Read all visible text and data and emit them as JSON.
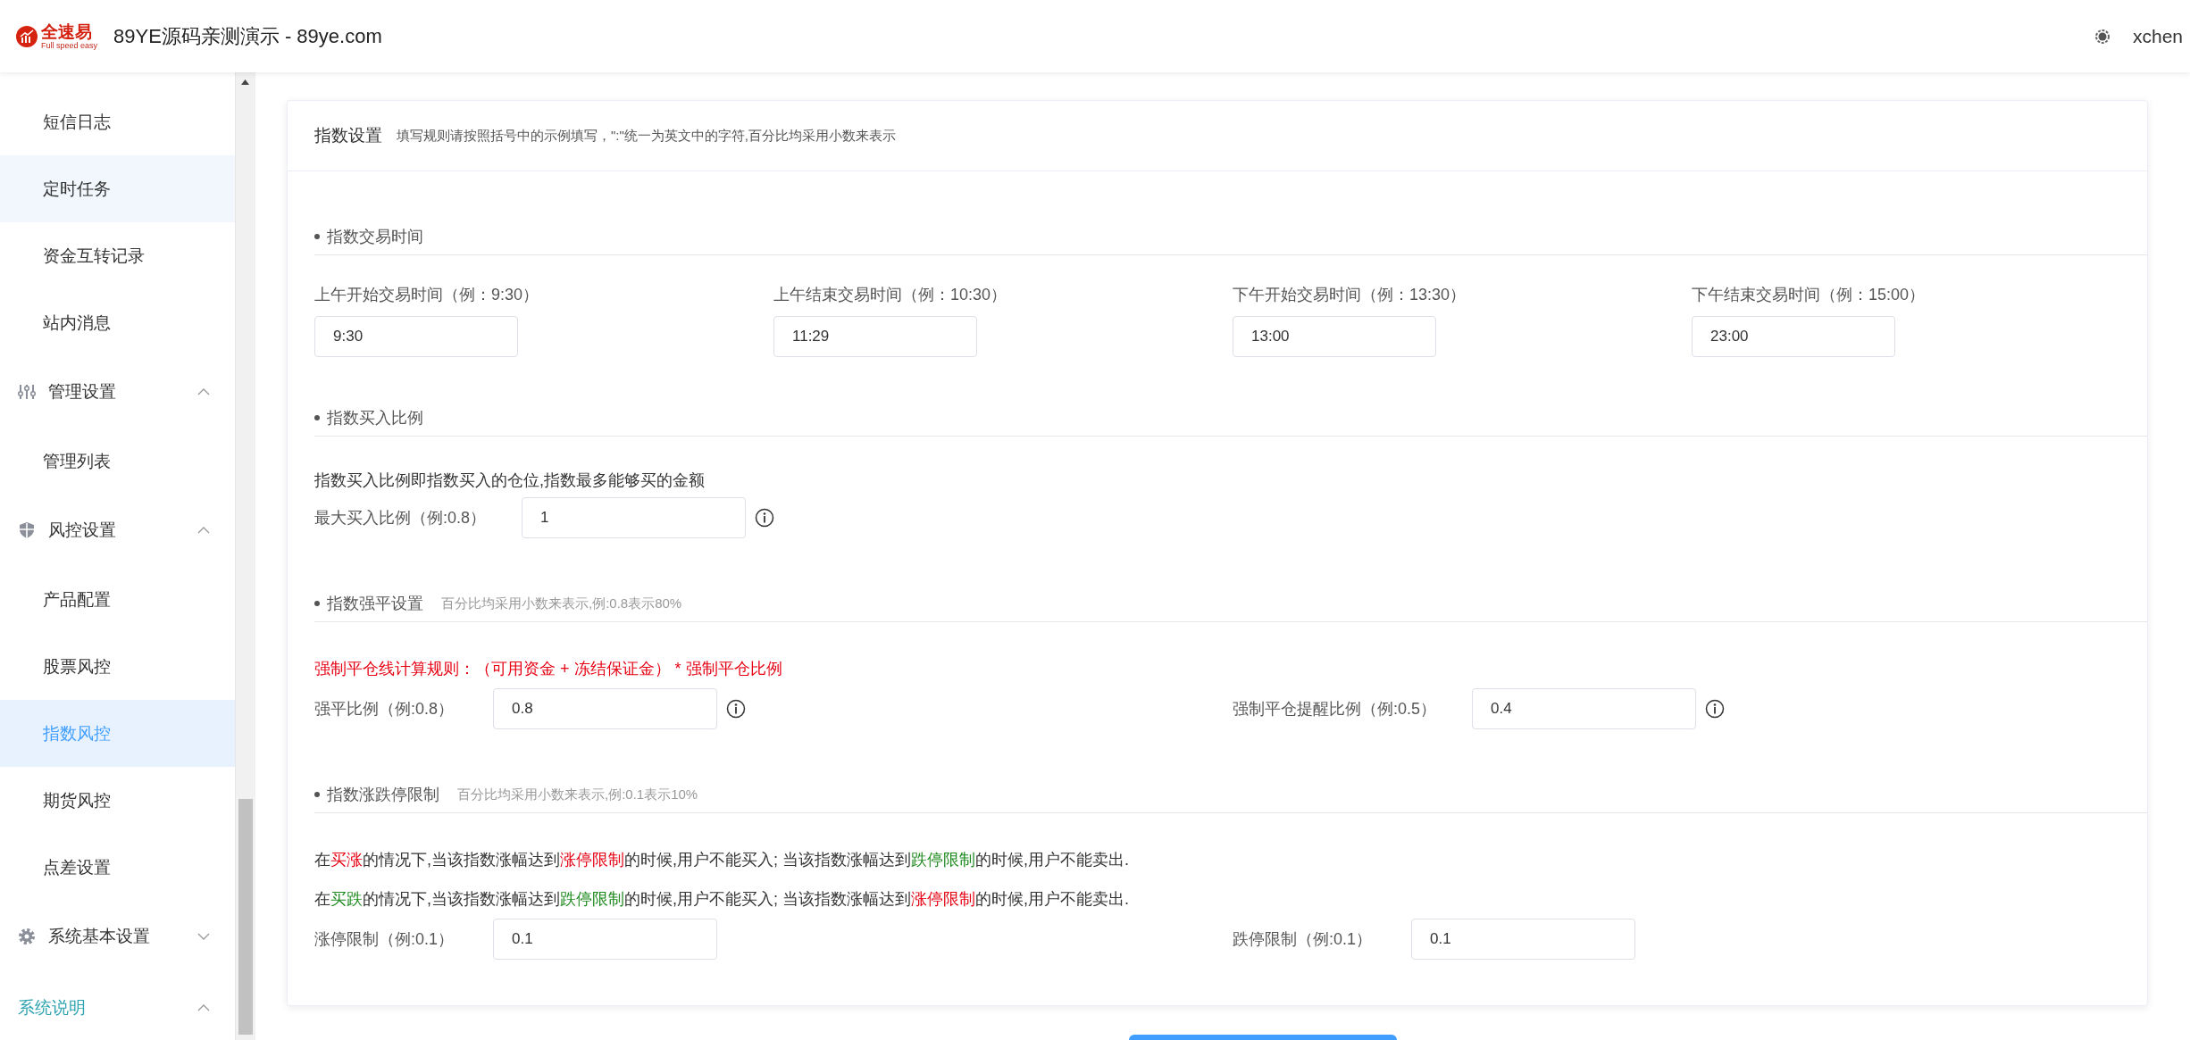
{
  "header": {
    "brand": "全速易",
    "brand_sub": "Full speed easy",
    "title": "89YE源码亲测演示 - 89ye.com",
    "user": "xchen"
  },
  "sidebar": {
    "items": [
      {
        "kind": "leaf",
        "label": "短信日志",
        "selected": false,
        "highlighted": false
      },
      {
        "kind": "leaf",
        "label": "定时任务",
        "selected": false,
        "highlighted": true
      },
      {
        "kind": "leaf",
        "label": "资金互转记录",
        "selected": false,
        "highlighted": false
      },
      {
        "kind": "leaf",
        "label": "站内消息",
        "selected": false,
        "highlighted": false
      },
      {
        "kind": "group",
        "label": "管理设置",
        "expanded": true,
        "active": false,
        "children": [
          {
            "label": "管理列表",
            "selected": false,
            "highlighted": false
          }
        ]
      },
      {
        "kind": "group",
        "label": "风控设置",
        "expanded": true,
        "active": false,
        "children": [
          {
            "label": "产品配置",
            "selected": false,
            "highlighted": false
          },
          {
            "label": "股票风控",
            "selected": false,
            "highlighted": false
          },
          {
            "label": "指数风控",
            "selected": true,
            "highlighted": false
          },
          {
            "label": "期货风控",
            "selected": false,
            "highlighted": false
          },
          {
            "label": "点差设置",
            "selected": false,
            "highlighted": false
          }
        ]
      },
      {
        "kind": "group",
        "label": "系统基本设置",
        "expanded": false,
        "active": false
      },
      {
        "kind": "group",
        "label": "系统说明",
        "expanded": true,
        "active": true
      }
    ]
  },
  "card": {
    "title": "指数设置",
    "hint": "填写规则请按照括号中的示例填写，\":\"统一为英文中的字符,百分比均采用小数来表示",
    "sections": [
      {
        "kind": "stacked",
        "title": "指数交易时间",
        "fields": [
          {
            "label": "上午开始交易时间（例：9:30）",
            "value": "9:30",
            "info": false
          },
          {
            "label": "上午结束交易时间（例：10:30）",
            "value": "11:29",
            "info": false
          },
          {
            "label": "下午开始交易时间（例：13:30）",
            "value": "13:00",
            "info": false
          },
          {
            "label": "下午结束交易时间（例：15:00）",
            "value": "23:00",
            "info": false
          }
        ]
      },
      {
        "kind": "inline",
        "title": "指数买入比例",
        "notes": [
          {
            "segments": [
              {
                "text": "指数买入比例即指数买入的仓位,指数最多能够买的金额",
                "color": "#333333"
              }
            ]
          }
        ],
        "fields": [
          {
            "label": "最大买入比例（例:0.8）",
            "value": "1",
            "info": true
          }
        ]
      },
      {
        "kind": "inline",
        "title": "指数强平设置",
        "hint": "百分比均采用小数来表示,例:0.8表示80%",
        "notes": [
          {
            "segments": [
              {
                "text": "强制平仓线计算规则：（可用资金 + 冻结保证金） * 强制平仓比例",
                "color": "#e60012"
              }
            ]
          }
        ],
        "fields": [
          {
            "label": "强平比例（例:0.8）",
            "value": "0.8",
            "info": true
          },
          {
            "label": "强制平仓提醒比例（例:0.5）",
            "value": "0.4",
            "info": true
          }
        ]
      },
      {
        "kind": "inline",
        "title": "指数涨跌停限制",
        "hint": "百分比均采用小数来表示,例:0.1表示10%",
        "notes": [
          {
            "segments": [
              {
                "text": "在",
                "color": "#333333"
              },
              {
                "text": "买涨",
                "color": "#e60012"
              },
              {
                "text": "的情况下,当该指数涨幅达到",
                "color": "#333333"
              },
              {
                "text": "涨停限制",
                "color": "#e60012"
              },
              {
                "text": "的时候,用户不能买入; 当该指数涨幅达到",
                "color": "#333333"
              },
              {
                "text": "跌停限制",
                "color": "#1e8a1e"
              },
              {
                "text": "的时候,用户不能卖出.",
                "color": "#333333"
              }
            ]
          },
          {
            "segments": [
              {
                "text": "在",
                "color": "#333333"
              },
              {
                "text": "买跌",
                "color": "#1e8a1e"
              },
              {
                "text": "的情况下,当该指数涨幅达到",
                "color": "#333333"
              },
              {
                "text": "跌停限制",
                "color": "#1e8a1e"
              },
              {
                "text": "的时候,用户不能买入; 当该指数涨幅达到",
                "color": "#333333"
              },
              {
                "text": "涨停限制",
                "color": "#e60012"
              },
              {
                "text": "的时候,用户不能卖出.",
                "color": "#333333"
              }
            ]
          }
        ],
        "fields": [
          {
            "label": "涨停限制（例:0.1）",
            "value": "0.1",
            "info": false
          },
          {
            "label": "跌停限制（例:0.1）",
            "value": "0.1",
            "info": false
          }
        ]
      }
    ]
  }
}
